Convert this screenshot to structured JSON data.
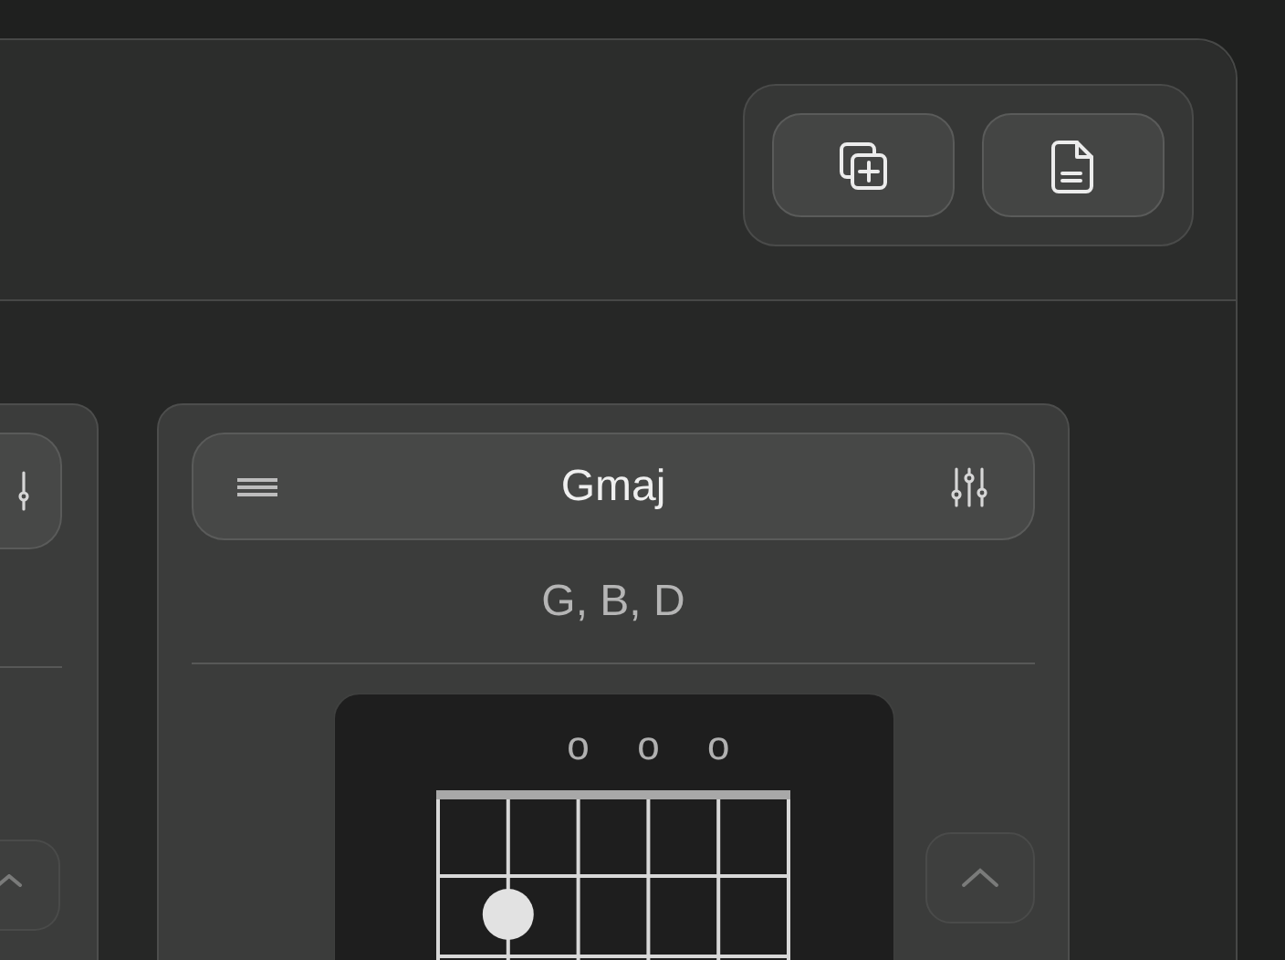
{
  "toolbar": {
    "buttons": [
      {
        "kind": "duplicate"
      },
      {
        "kind": "document"
      }
    ]
  },
  "chords": [
    {
      "name": "Gmaj",
      "notes": "G, B, D",
      "strings": [
        {
          "kind": "plain"
        },
        {
          "kind": "dot"
        },
        {
          "kind": "open",
          "mark": "o"
        },
        {
          "kind": "open",
          "mark": "o"
        },
        {
          "kind": "open",
          "mark": "o"
        },
        {
          "kind": "plain"
        }
      ]
    }
  ]
}
